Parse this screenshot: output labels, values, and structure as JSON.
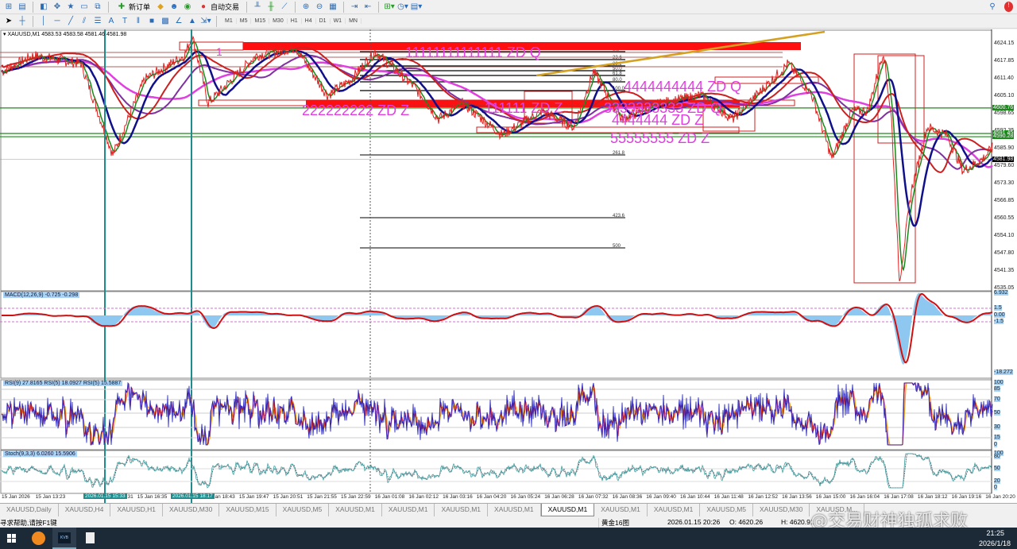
{
  "toolbar": {
    "new_order_label": "新订单",
    "auto_trade_label": "自动交易",
    "timeframes": [
      "M1",
      "M5",
      "M15",
      "M30",
      "H1",
      "H4",
      "D1",
      "W1",
      "MN"
    ]
  },
  "chart": {
    "header": "XAUUSD,M1  4583.53 4583.58 4581.46 4581.98",
    "price_ticks": [
      "4624.15",
      "4617.85",
      "4611.40",
      "4605.10",
      "4598.65",
      "4592.35",
      "4585.90",
      "4579.60",
      "4573.30",
      "4566.85",
      "4560.55",
      "4554.10",
      "4547.80",
      "4541.35",
      "4535.05"
    ],
    "price_range": [
      4535.05,
      4624.15
    ],
    "current_price": "4581.98",
    "green_levels": [
      "4600.76",
      "4591.45",
      "4590.28"
    ],
    "fib_levels": [
      "0.0",
      "23.6",
      "38.2",
      "50.0",
      "61.8",
      "80.0",
      "100.0",
      "261.8",
      "423.6",
      "500"
    ],
    "annotations": [
      "1",
      "11111111111111 ZD Q",
      "222222222 ZD Z",
      "111111 ZD Z",
      "3333333333 ZD Q",
      "4444444444 ZD Q",
      "4444444 ZD Z",
      "55555555 ZD Z"
    ],
    "price_path": [
      [
        0,
        4614.0
      ],
      [
        40,
        4619.8
      ],
      [
        100,
        4616.9
      ],
      [
        140,
        4583.6
      ],
      [
        180,
        4611.1
      ],
      [
        230,
        4619.8
      ],
      [
        240,
        4627.0
      ],
      [
        260,
        4602.5
      ],
      [
        320,
        4619.8
      ],
      [
        370,
        4622.7
      ],
      [
        410,
        4605.3
      ],
      [
        440,
        4611.1
      ],
      [
        470,
        4621.3
      ],
      [
        520,
        4608.2
      ],
      [
        550,
        4596.7
      ],
      [
        580,
        4602.5
      ],
      [
        630,
        4590.9
      ],
      [
        680,
        4599.6
      ],
      [
        720,
        4593.8
      ],
      [
        745,
        4614.0
      ],
      [
        780,
        4596.7
      ],
      [
        830,
        4602.5
      ],
      [
        880,
        4605.3
      ],
      [
        920,
        4596.7
      ],
      [
        960,
        4608.2
      ],
      [
        990,
        4616.9
      ],
      [
        1020,
        4605.3
      ],
      [
        1045,
        4582.2
      ],
      [
        1070,
        4599.6
      ],
      [
        1090,
        4599.6
      ],
      [
        1110,
        4621.3
      ],
      [
        1120,
        4596.7
      ],
      [
        1130,
        4537.4
      ],
      [
        1145,
        4570.6
      ],
      [
        1165,
        4593.8
      ],
      [
        1190,
        4590.9
      ],
      [
        1210,
        4577.9
      ],
      [
        1235,
        4582.2
      ],
      [
        1248,
        4586.5
      ]
    ]
  },
  "macd": {
    "label": "MACD(12,26,9) -0.725 -0.298",
    "ticks": [
      "6.932",
      "1.5",
      "0.00",
      "-1.5",
      "-18.272"
    ]
  },
  "rsi": {
    "label": "RSI(9) 27.8165  RSI(5) 18.0927  RSI(5) 15.5887",
    "ticks": [
      "100",
      "85",
      "70",
      "50",
      "30",
      "15",
      "0"
    ]
  },
  "stoch": {
    "label": "Stoch(9,3,3) 6.0260 15.5906",
    "ticks": [
      "100",
      "80",
      "50",
      "20",
      "0"
    ]
  },
  "time_axis": {
    "labels": [
      "15 Jan 2026",
      "15 Jan 13:23",
      "",
      "15 Jan 15:31",
      "15 Jan 16:35",
      "",
      "15 Jan 18:43",
      "15 Jan 19:47",
      "15 Jan 20:51",
      "15 Jan 21:55",
      "15 Jan 22:59",
      "16 Jan 01:08",
      "16 Jan 02:12",
      "16 Jan 03:16",
      "16 Jan 04:20",
      "16 Jan 05:24",
      "16 Jan 06:28",
      "16 Jan 07:32",
      "16 Jan 08:36",
      "16 Jan 09:40",
      "16 Jan 10:44",
      "16 Jan 11:48",
      "16 Jan 12:52",
      "16 Jan 13:56",
      "16 Jan 15:00",
      "16 Jan 16:04",
      "16 Jan 17:08",
      "16 Jan 18:12",
      "16 Jan 19:16",
      "16 Jan 20:20"
    ],
    "cursor_labels": [
      "2026.01.15 15:33",
      "2026.01.15 18:17"
    ]
  },
  "tabs": [
    "XAUUSD,Daily",
    "XAUUSD,H4",
    "XAUUSD,H1",
    "XAUUSD,M30",
    "XAUUSD,M15",
    "XAUUSD,M5",
    "XAUUSD,M1",
    "XAUUSD,M1",
    "XAUUSD,M1",
    "XAUUSD,M1",
    "XAUUSD,M1",
    "XAUUSD,M1",
    "XAUUSD,M1",
    "XAUUSD,M5",
    "XAUUSD,M30",
    "XAUUSD,M..."
  ],
  "active_tab": 10,
  "status": {
    "help": "寻求帮助,请按F1键",
    "profile": "黄金16图",
    "datetime": "2026.01.15 20:26",
    "open": "O: 4620.26",
    "high": "H: 4620.91"
  },
  "watermark": "@交易财神独孤求败",
  "taskbar": {
    "time": "21:25",
    "date": "2026/1/18"
  }
}
